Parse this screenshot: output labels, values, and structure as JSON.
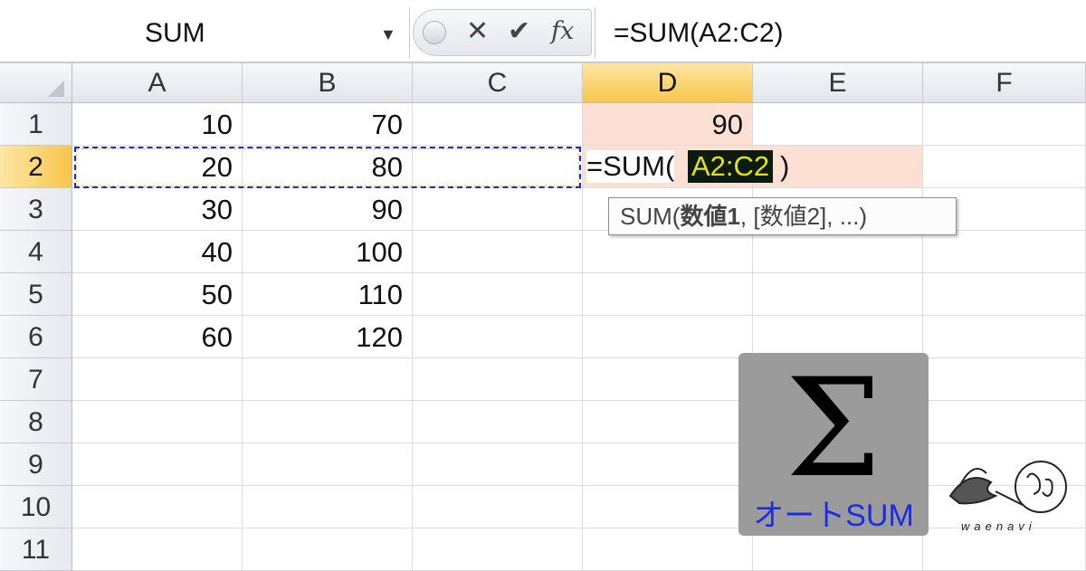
{
  "formula_bar": {
    "name_box": "SUM",
    "formula": "=SUM(A2:C2)"
  },
  "columns": [
    "A",
    "B",
    "C",
    "D",
    "E",
    "F"
  ],
  "rows": [
    "1",
    "2",
    "3",
    "4",
    "5",
    "6",
    "7",
    "8",
    "9",
    "10",
    "11"
  ],
  "cells": {
    "A": [
      "10",
      "20",
      "30",
      "40",
      "50",
      "60",
      "",
      "",
      "",
      "",
      ""
    ],
    "B": [
      "70",
      "80",
      "90",
      "100",
      "110",
      "120",
      "",
      "",
      "",
      "",
      ""
    ],
    "D": [
      "90",
      "",
      "",
      "",
      "",
      "",
      "",
      "",
      "",
      "",
      ""
    ]
  },
  "edit": {
    "prefix": "=SUM(",
    "range": "A2:C2",
    "suffix": ")"
  },
  "tooltip": {
    "text_plain": "SUM(",
    "text_bold": "数値1",
    "text_rest": ", [数値2], ...)"
  },
  "overlay": {
    "symbol": "Σ",
    "label": "オートSUM",
    "logo_text": "waenavi"
  },
  "colors": {
    "accent_blue": "#1b2de0",
    "highlight": "#fbe0d3",
    "active_header": "#f8c54a"
  }
}
